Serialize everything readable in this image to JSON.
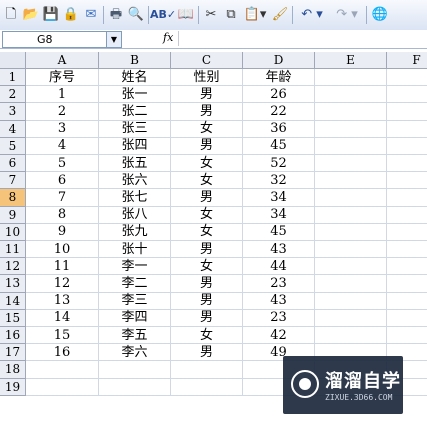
{
  "toolbar": {
    "icons": [
      "new-icon",
      "open-icon",
      "save-icon",
      "permission-icon",
      "email-icon",
      "print-icon",
      "print-preview-icon",
      "spelling-icon",
      "research-icon",
      "cut-icon",
      "copy-icon",
      "paste-icon",
      "format-painter-icon",
      "undo-icon",
      "redo-icon",
      "hyperlink-icon"
    ]
  },
  "formula_bar": {
    "name_box": "G8",
    "fx_label": "fx",
    "formula": ""
  },
  "columns": [
    "A",
    "B",
    "C",
    "D",
    "E",
    "F"
  ],
  "rows": [
    "1",
    "2",
    "3",
    "4",
    "5",
    "6",
    "7",
    "8",
    "9",
    "10",
    "11",
    "12",
    "13",
    "14",
    "15",
    "16",
    "17",
    "18",
    "19"
  ],
  "selected_row": "8",
  "header_row": [
    "序号",
    "姓名",
    "性别",
    "年龄"
  ],
  "data": [
    [
      "1",
      "张一",
      "男",
      "26"
    ],
    [
      "2",
      "张二",
      "男",
      "22"
    ],
    [
      "3",
      "张三",
      "女",
      "36"
    ],
    [
      "4",
      "张四",
      "男",
      "45"
    ],
    [
      "5",
      "张五",
      "女",
      "52"
    ],
    [
      "6",
      "张六",
      "女",
      "32"
    ],
    [
      "7",
      "张七",
      "男",
      "34"
    ],
    [
      "8",
      "张八",
      "女",
      "34"
    ],
    [
      "9",
      "张九",
      "女",
      "45"
    ],
    [
      "10",
      "张十",
      "男",
      "43"
    ],
    [
      "11",
      "李一",
      "女",
      "44"
    ],
    [
      "12",
      "李二",
      "男",
      "23"
    ],
    [
      "13",
      "李三",
      "男",
      "43"
    ],
    [
      "14",
      "李四",
      "男",
      "23"
    ],
    [
      "15",
      "李五",
      "女",
      "42"
    ],
    [
      "16",
      "李六",
      "男",
      "49"
    ]
  ],
  "watermark": {
    "title": "溜溜自学",
    "subtitle": "ZIXUE.3D66.COM"
  }
}
